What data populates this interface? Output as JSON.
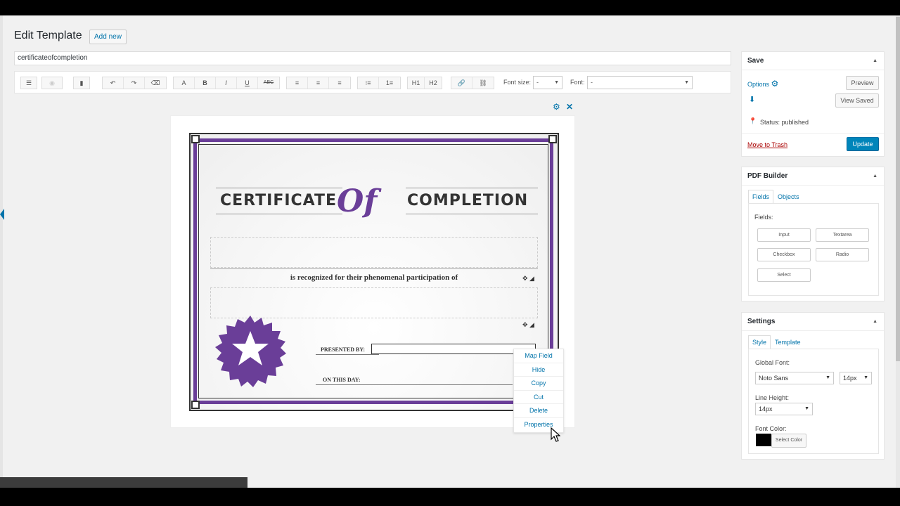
{
  "header": {
    "title": "Edit Template",
    "add_new_label": "Add new"
  },
  "template_name": {
    "value": "certificateofcompletion"
  },
  "toolbar": {
    "font_size_label": "Font size:",
    "font_size_value": "-",
    "font_label": "Font:",
    "font_value": "-",
    "h1": "H1",
    "h2": "H2",
    "text_color": "A",
    "bold": "B",
    "italic": "I",
    "underline": "U",
    "strike": "ABC"
  },
  "certificate": {
    "word1": "CERTIFICATE",
    "of": "Of",
    "word2": "COMPLETION",
    "recognized": "is recognized for their phenomenal participation of",
    "presented_by": "PRESENTED BY:",
    "on_this_day": "ON THIS DAY:"
  },
  "context_menu": {
    "items": [
      "Map Field",
      "Hide",
      "Copy",
      "Cut",
      "Delete",
      "Properties"
    ]
  },
  "save_box": {
    "title": "Save",
    "options_label": "Options",
    "preview_label": "Preview",
    "view_saved_label": "View Saved",
    "status": "Status: published",
    "trash_label": "Move to Trash",
    "update_label": "Update"
  },
  "pdf_builder": {
    "title": "PDF Builder",
    "tabs": [
      "Fields",
      "Objects"
    ],
    "fields_label": "Fields:",
    "field_buttons": [
      "Input",
      "Textarea",
      "Checkbox",
      "Radio",
      "Select"
    ]
  },
  "settings": {
    "title": "Settings",
    "tabs": [
      "Style",
      "Template"
    ],
    "global_font_label": "Global Font:",
    "global_font_value": "Noto Sans",
    "global_font_size": "14px",
    "line_height_label": "Line Height:",
    "line_height_value": "14px",
    "font_color_label": "Font Color:",
    "select_color_label": "Select Color",
    "font_color": "#000000"
  },
  "colors": {
    "accent": "#0073aa",
    "primary_button": "#0085ba",
    "certificate_purple": "#6a3e98",
    "trash_link": "#a00"
  }
}
